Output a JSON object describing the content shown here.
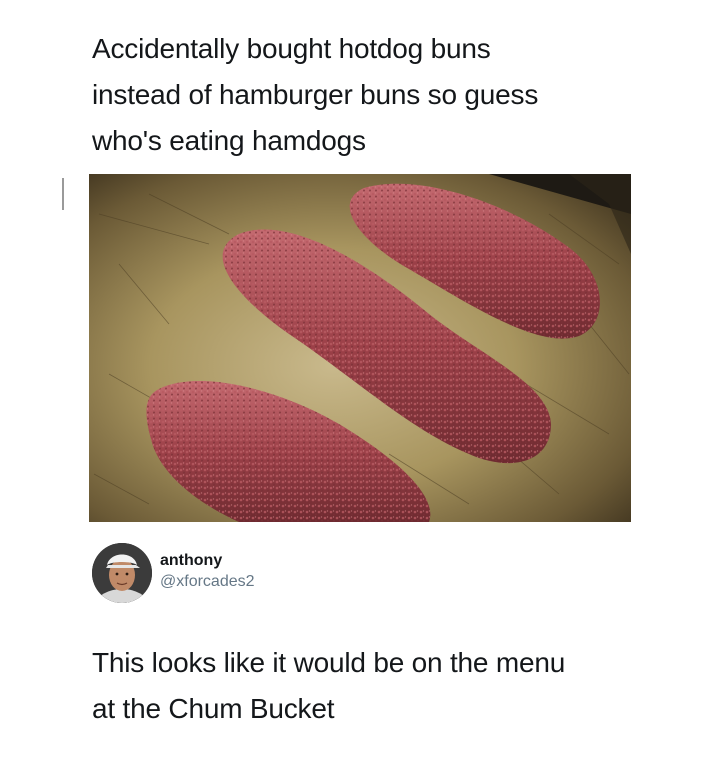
{
  "post": {
    "text": "Accidentally bought hotdog buns\ninstead of hamburger buns so guess\nwho's eating hamdogs",
    "image": {
      "subject": "hamdogs-on-baking-tray",
      "colors": {
        "tray_light": "#b8a67a",
        "tray_dark": "#5a4a2e",
        "meat": "#9c4048",
        "meat_dark": "#6e2a30",
        "meat_light": "#c46a70"
      }
    }
  },
  "reply": {
    "author": {
      "name": "anthony",
      "handle": "@xforcades2"
    },
    "text": "This looks like it would be on the menu\nat the Chum Bucket"
  },
  "colors": {
    "text": "#14171a",
    "secondary_text": "#657786",
    "background": "#ffffff"
  }
}
